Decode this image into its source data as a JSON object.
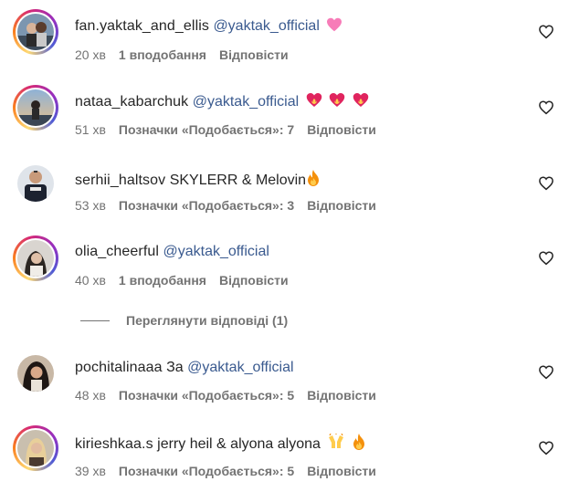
{
  "comments": [
    {
      "username": "fan.yaktak_and_ellis",
      "mention": "@yaktak_official",
      "text": "",
      "emojis": [
        "pink-heart"
      ],
      "time": "20 хв",
      "likes": "1 вподобання",
      "reply": "Відповісти",
      "avatar_ring": true
    },
    {
      "username": "nataa_kabarchuk",
      "mention": "@yaktak_official",
      "text": "",
      "emojis": [
        "heart-on-fire",
        "heart-on-fire",
        "heart-on-fire"
      ],
      "time": "51 хв",
      "likes": "Позначки «Подобається»: 7",
      "reply": "Відповісти",
      "avatar_ring": true
    },
    {
      "username": "serhii_haltsov",
      "mention": "",
      "text": "SKYLERR & Melovin",
      "emojis": [
        "fire"
      ],
      "time": "53 хв",
      "likes": "Позначки «Подобається»: 3",
      "reply": "Відповісти",
      "avatar_ring": false
    },
    {
      "username": "olia_cheerful",
      "mention": "@yaktak_official",
      "text": "",
      "emojis": [],
      "time": "40 хв",
      "likes": "1 вподобання",
      "reply": "Відповісти",
      "avatar_ring": true
    },
    {
      "username": "pochitalinaaa",
      "mention": "@yaktak_official",
      "text": "За",
      "emojis": [],
      "time": "48 хв",
      "likes": "Позначки «Подобається»: 5",
      "reply": "Відповісти",
      "avatar_ring": false
    },
    {
      "username": "kirieshkaa.s",
      "mention": "",
      "text": "jerry heil & alyona alyona",
      "emojis": [
        "raising-hands",
        "fire"
      ],
      "time": "39 хв",
      "likes": "Позначки «Подобається»: 5",
      "reply": "Відповісти",
      "avatar_ring": true
    }
  ],
  "view_replies": "Переглянути відповіді (1)",
  "colors": {
    "mention": "#3a5a8f",
    "meta": "#737373",
    "text": "#262626"
  }
}
